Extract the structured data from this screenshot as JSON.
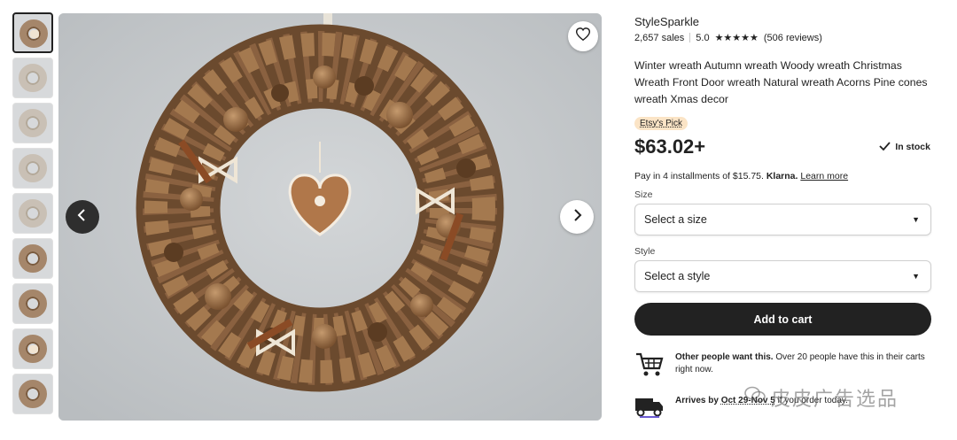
{
  "shop": {
    "name": "StyleSparkle",
    "sales": "2,657 sales",
    "rating": "5.0",
    "stars": "★★★★★",
    "reviews": "(506 reviews)"
  },
  "product": {
    "title": "Winter wreath Autumn wreath Woody wreath Christmas Wreath Front Door wreath Natural wreath Acorns Pine cones wreath Xmas decor",
    "badge": "Etsy's Pick",
    "price": "$63.02+",
    "stock": "In stock"
  },
  "klarna": {
    "text": "Pay in 4 installments of $15.75.",
    "brand": "Klarna.",
    "link": "Learn more"
  },
  "options": {
    "size_label": "Size",
    "size_value": "Select a size",
    "style_label": "Style",
    "style_value": "Select a style"
  },
  "cart": {
    "label": "Add to cart"
  },
  "demand": {
    "bold": "Other people want this.",
    "text": " Over 20 people have this in their carts right now."
  },
  "shipping": {
    "prefix": "Arrives by",
    "dates": "Oct 29-Nov 5",
    "suffix": " if you order today."
  },
  "watermark": "皮皮广告选品",
  "icons": {
    "favorite": "heart-icon",
    "prev": "chevron-left-icon",
    "next": "chevron-right-icon",
    "check": "check-icon",
    "cart": "shopping-cart-icon",
    "truck": "truck-icon",
    "dropdown": "caret-down-icon"
  },
  "thumbnails": [
    {
      "active": true,
      "style": "brown"
    },
    {
      "active": false,
      "style": "pale"
    },
    {
      "active": false,
      "style": "pale"
    },
    {
      "active": false,
      "style": "pale"
    },
    {
      "active": false,
      "style": "pale"
    },
    {
      "active": false,
      "style": "brown"
    },
    {
      "active": false,
      "style": "brown"
    },
    {
      "active": false,
      "style": "brown"
    },
    {
      "active": false,
      "style": "brown"
    }
  ]
}
